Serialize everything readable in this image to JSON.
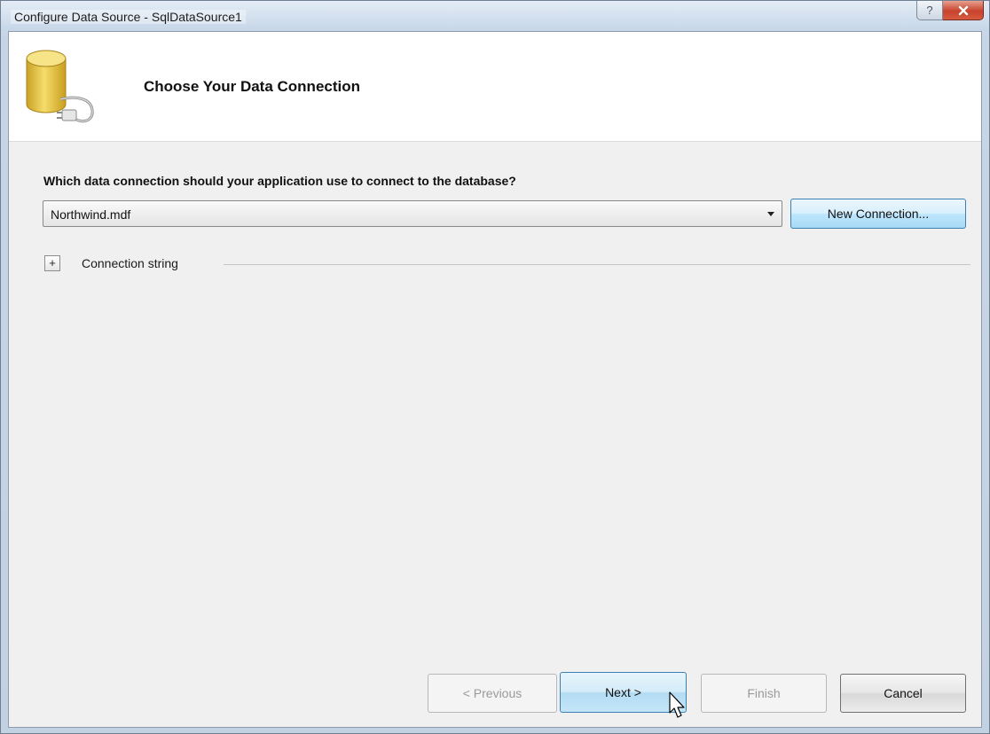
{
  "window": {
    "title": "Configure Data Source - SqlDataSource1",
    "help_icon": "question-mark-icon",
    "close_icon": "close-x-icon",
    "close_color": "#c7422c"
  },
  "header": {
    "icon": "database-plug-icon",
    "title": "Choose Your Data Connection"
  },
  "main": {
    "question": "Which data connection should your application use to connect to the database?",
    "connection_select": {
      "value": "Northwind.mdf"
    },
    "new_connection_label": "New Connection...",
    "expander_symbol": "+",
    "connection_string_label": "Connection string"
  },
  "footer": {
    "previous_label": "< Previous",
    "next_label": "Next >",
    "finish_label": "Finish",
    "cancel_label": "Cancel"
  },
  "colors": {
    "accent_button": "#bee6fd",
    "accent_border": "#3c7fb1",
    "db_icon": "#e8c64a"
  }
}
